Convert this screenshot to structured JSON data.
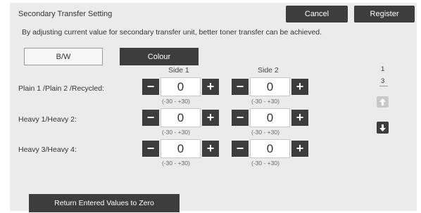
{
  "header": {
    "title": "Secondary Transfer Setting",
    "cancel_label": "Cancel",
    "register_label": "Register"
  },
  "description": "By adjusting current value for secondary transfer unit, better toner transfer can be achieved.",
  "tabs": [
    {
      "label": "B/W",
      "selected": false
    },
    {
      "label": "Colour",
      "selected": true
    }
  ],
  "columns": [
    "Side 1",
    "Side 2"
  ],
  "rows": [
    {
      "label": "Plain 1 /Plain 2 /Recycled:",
      "side1": "0",
      "side2": "0",
      "range": "(-30 - +30)"
    },
    {
      "label": "Heavy 1/Heavy 2:",
      "side1": "0",
      "side2": "0",
      "range": "(-30 - +30)"
    },
    {
      "label": "Heavy 3/Heavy 4:",
      "side1": "0",
      "side2": "0",
      "range": "(-30 - +30)"
    }
  ],
  "stepper": {
    "minus": "−",
    "plus": "+"
  },
  "pager": {
    "current": "1",
    "total": "3",
    "up_icon": "arrow-up",
    "down_icon": "arrow-down"
  },
  "reset_label": "Return Entered Values to Zero",
  "colors": {
    "dark_button": "#3d3d3d",
    "panel": "#ebebeb",
    "disabled": "#c9c9c9"
  }
}
